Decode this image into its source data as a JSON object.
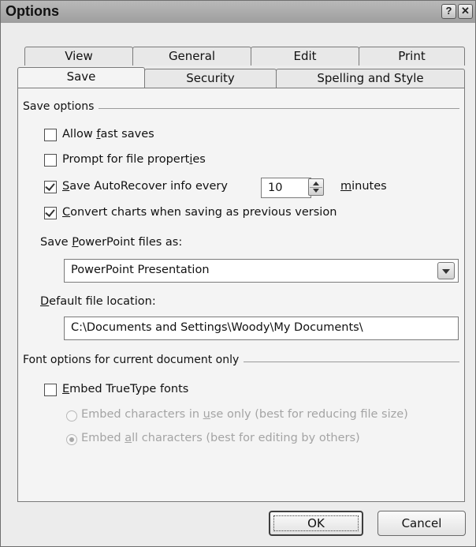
{
  "window": {
    "title": "Options",
    "help_button": "?",
    "close_button": "✕"
  },
  "tabs_row1": [
    "View",
    "General",
    "Edit",
    "Print"
  ],
  "tabs_row2": [
    "Save",
    "Security",
    "Spelling and Style"
  ],
  "active_tab": "Save",
  "save_options": {
    "group_label": "Save options",
    "allow_fast_saves": {
      "label_pre": "Allow ",
      "label_u": "f",
      "label_post": "ast saves",
      "checked": false
    },
    "prompt_props": {
      "label_pre": "Prompt for file propert",
      "label_u": "i",
      "label_post": "es",
      "checked": false
    },
    "autorecover": {
      "label_pre": "",
      "label_u": "S",
      "label_post": "ave AutoRecover info every",
      "checked": true,
      "value": "10",
      "unit_u": "m",
      "unit_post": "inutes"
    },
    "convert_charts": {
      "label_pre": "",
      "label_u": "C",
      "label_post": "onvert charts when saving as previous version",
      "checked": true
    },
    "save_as_label_pre": "Save ",
    "save_as_label_u": "P",
    "save_as_label_post": "owerPoint files as:",
    "save_as_value": "PowerPoint Presentation",
    "location_label_pre": "",
    "location_label_u": "D",
    "location_label_post": "efault file location:",
    "location_value": "C:\\Documents and Settings\\Woody\\My Documents\\"
  },
  "font_options": {
    "group_label": "Font options for current document only",
    "embed": {
      "label_pre": "",
      "label_u": "E",
      "label_post": "mbed TrueType fonts",
      "checked": false
    },
    "radio_in_use": {
      "label_pre": "Embed characters in ",
      "label_u": "u",
      "label_post": "se only (best for reducing file size)",
      "selected": false
    },
    "radio_all": {
      "label_pre": "Embed ",
      "label_u": "a",
      "label_post": "ll characters (best for editing by others)",
      "selected": true
    }
  },
  "buttons": {
    "ok": "OK",
    "cancel": "Cancel"
  }
}
